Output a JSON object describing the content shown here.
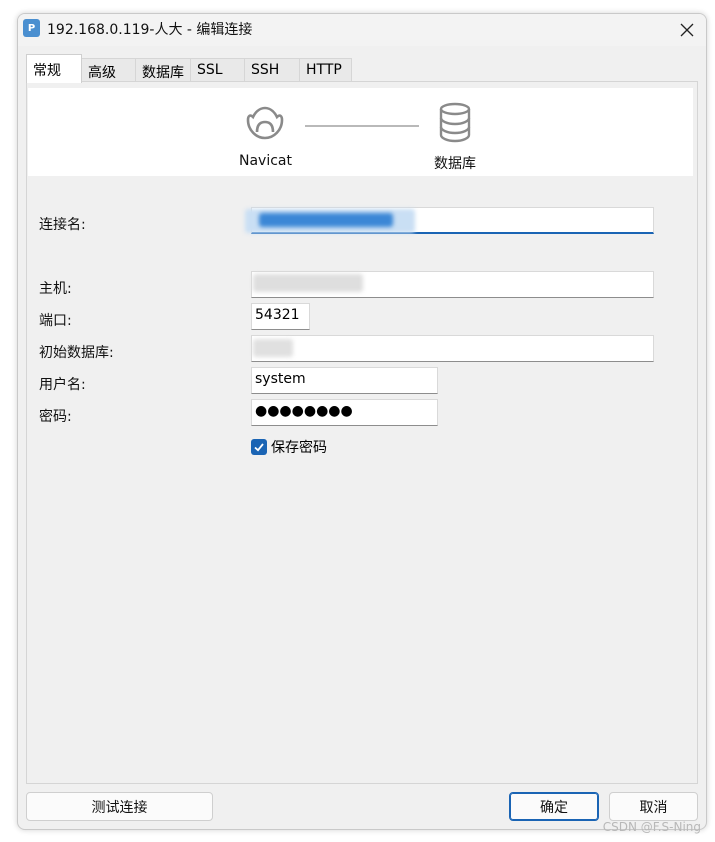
{
  "window": {
    "title": "192.168.0.119-人大 - 编辑连接",
    "icon": "postgresql-elephant-icon"
  },
  "tabs": [
    {
      "label": "常规",
      "active": true
    },
    {
      "label": "高级",
      "active": false
    },
    {
      "label": "数据库",
      "active": false
    },
    {
      "label": "SSL",
      "active": false
    },
    {
      "label": "SSH",
      "active": false
    },
    {
      "label": "HTTP",
      "active": false
    }
  ],
  "banner": {
    "left_label": "Navicat",
    "right_label": "数据库"
  },
  "form": {
    "connection_name_label": "连接名:",
    "host_label": "主机:",
    "port_label": "端口:",
    "port_value": "54321",
    "initial_db_label": "初始数据库:",
    "username_label": "用户名:",
    "username_value": "system",
    "password_label": "密码:",
    "password_value": "●●●●●●●●",
    "save_password_label": "保存密码",
    "save_password_checked": true
  },
  "buttons": {
    "test_connection": "测试连接",
    "ok": "确定",
    "cancel": "取消"
  },
  "colors": {
    "accent": "#1a64b4",
    "window_bg": "#f0f0f0"
  },
  "watermark": "CSDN @F.S-Ning"
}
